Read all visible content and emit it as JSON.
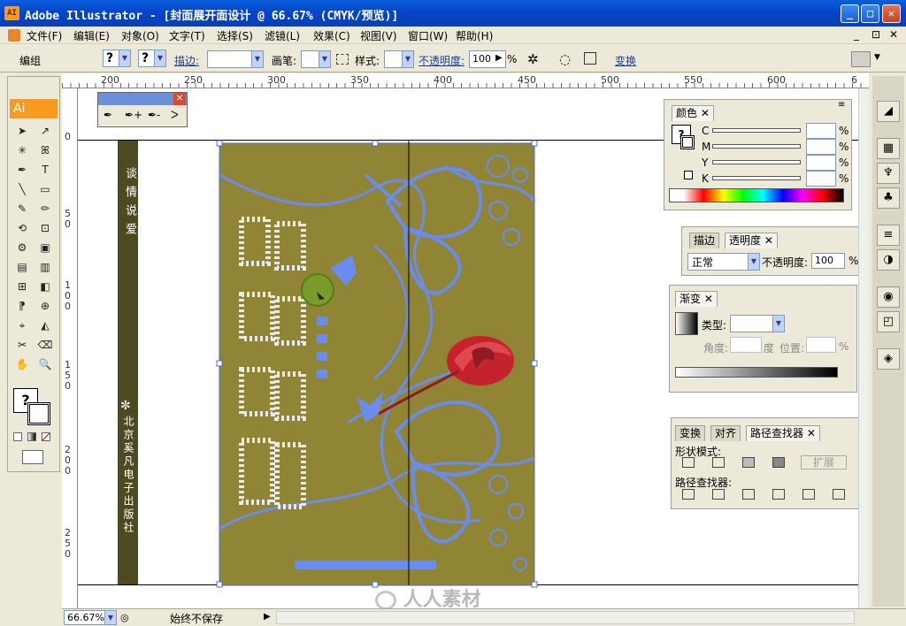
{
  "window": {
    "app_icon": "AI",
    "title": "Adobe Illustrator - [封面展开面设计 @ 66.67% (CMYK/预览)]",
    "minimize": "_",
    "maximize": "□",
    "close": "✕",
    "doc_controls": [
      "_",
      "⊡",
      "✕"
    ]
  },
  "menu": [
    "文件(F)",
    "编辑(E)",
    "对象(O)",
    "文字(T)",
    "选择(S)",
    "滤镜(L)",
    "效果(C)",
    "视图(V)",
    "窗口(W)",
    "帮助(H)"
  ],
  "options": {
    "selection_label": "编组",
    "fill_q": "?",
    "stroke_q": "?",
    "stroke_label": "描边:",
    "brush_label": "画笔:",
    "style_label": "样式:",
    "opacity_label": "不透明度:",
    "opacity_value": "100",
    "percent": "%",
    "transform_label": "变换"
  },
  "pen_palette": {
    "close": "✕",
    "tools": [
      "✒",
      "✒+",
      "✒-",
      "ᐳ"
    ]
  },
  "toolbox": {
    "logo": "Ai",
    "fill_q": "?"
  },
  "rulers": {
    "top": [
      "200",
      "250",
      "300",
      "350",
      "400",
      "450",
      "500",
      "550",
      "600",
      "6"
    ],
    "left": [
      "0",
      "0",
      "5",
      "0",
      "1",
      "0",
      "0",
      "1",
      "5",
      "0",
      "2",
      "0",
      "0",
      "2",
      "5",
      "0"
    ]
  },
  "spine": {
    "title_chars": [
      "谈",
      "情",
      "说",
      "爱"
    ],
    "publisher_chars": [
      "北",
      "京",
      "奚",
      "凡",
      "电",
      "子",
      "出",
      "版",
      "社"
    ]
  },
  "color_panel": {
    "tab": "颜色",
    "labels": [
      "C",
      "M",
      "Y",
      "K"
    ],
    "percent": "%",
    "q": "?"
  },
  "transparency_panel": {
    "tabs": [
      "描边",
      "透明度"
    ],
    "mode": "正常",
    "opacity_label": "不透明度:",
    "opacity_value": "100",
    "percent": "%"
  },
  "gradient_panel": {
    "tab": "渐变",
    "type_label": "类型:",
    "angle_label": "角度:",
    "degree": "度",
    "location_label": "位置:",
    "percent": "%"
  },
  "pathfinder_panel": {
    "tabs": [
      "变换",
      "对齐",
      "路径查找器"
    ],
    "shape_modes_label": "形状模式:",
    "expand_label": "扩展",
    "pathfinders_label": "路径查找器:"
  },
  "status": {
    "zoom": "66.67%",
    "save_state": "始终不保存"
  },
  "watermark": "人人素材",
  "colors": {
    "cover_bg": "#8f8535",
    "spine": "#4d4920",
    "selection_blue": "#6b8cef",
    "rose": "#c4232d"
  }
}
